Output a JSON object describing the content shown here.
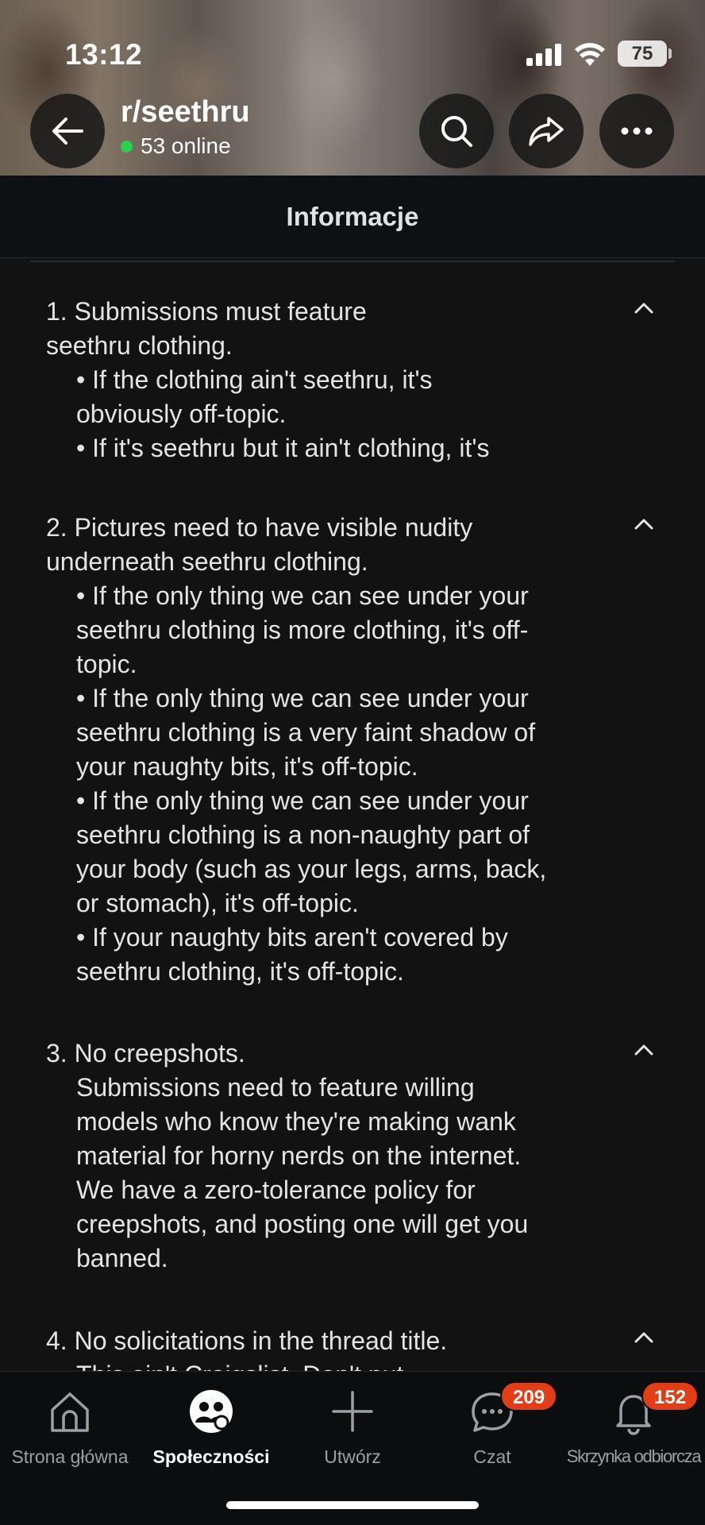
{
  "status_bar": {
    "time": "13:12",
    "battery": "75"
  },
  "header": {
    "subreddit": "r/seethru",
    "online": "53 online"
  },
  "page": {
    "title": "Informacje"
  },
  "rules": [
    {
      "title": "1. Submissions must feature seethru clothing.",
      "lines": [
        "• If the clothing ain't seethru, it's",
        "obviously off-topic.",
        "• If it's seethru but it ain't clothing, it's"
      ]
    },
    {
      "title": "2. Pictures need to have visible nudity underneath seethru clothing.",
      "lines": [
        "• If the only thing we can see under your",
        "seethru clothing is more clothing, it's off-",
        "topic.",
        "• If the only thing we can see under your",
        "seethru clothing is a very faint shadow of",
        "your naughty bits, it's off-topic.",
        "• If the only thing we can see under your",
        "seethru clothing is a non-naughty part of",
        "your body (such as your legs, arms, back,",
        "or stomach), it's off-topic.",
        "• If your naughty bits aren't covered by",
        "seethru clothing, it's off-topic."
      ]
    },
    {
      "title": "3. No creepshots.",
      "lines": [
        "Submissions need to feature willing",
        "models who know they're making wank",
        "material for horny nerds on the internet.",
        "We have a zero-tolerance policy for",
        "creepshots, and posting one will get you",
        "banned."
      ]
    },
    {
      "title": "4. No solicitations in the thread title.",
      "lines": [
        "This ain't Craigslist. Don't put"
      ]
    }
  ],
  "nav": {
    "home": "Strona główna",
    "communities": "Społeczności",
    "create": "Utwórz",
    "chat": "Czat",
    "chat_badge": "209",
    "inbox": "Skrzynka odbiorcza",
    "inbox_badge": "152"
  },
  "colors": {
    "background": "#121212",
    "online_dot": "#2ad14e",
    "badge": "#e13d17"
  }
}
